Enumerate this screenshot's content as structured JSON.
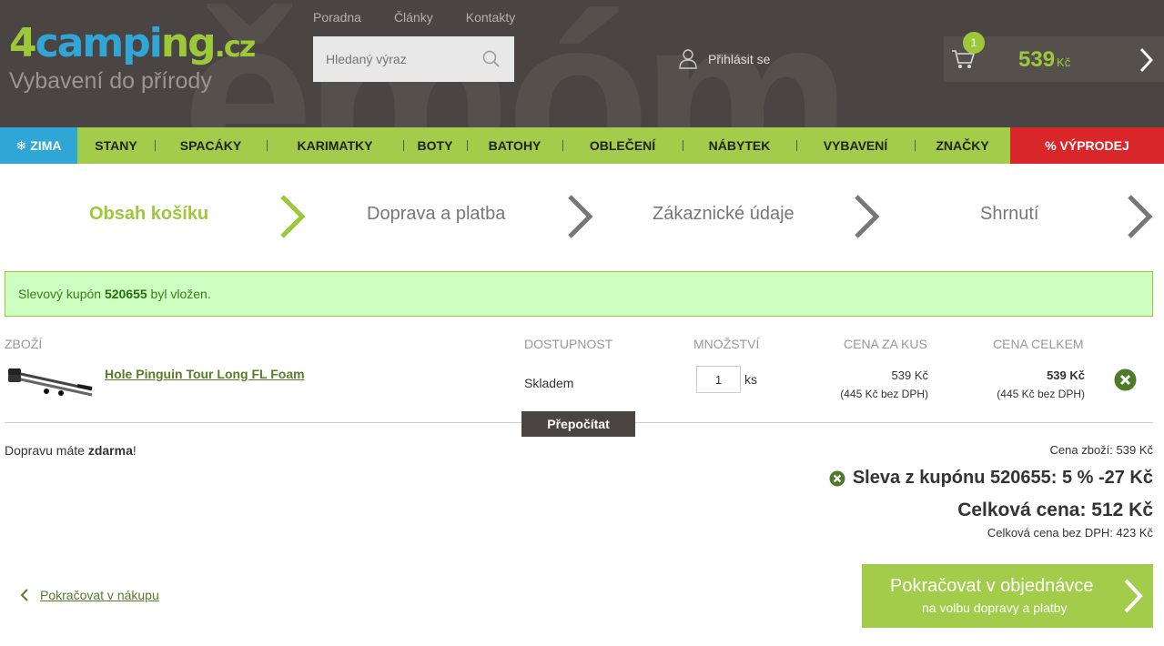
{
  "header": {
    "logo": {
      "four": "4",
      "camp": "campi",
      "ng": "ng",
      "cz": ".cz",
      "tagline": "Vybavení do přírody"
    },
    "toplinks": [
      "Poradna",
      "Články",
      "Kontakty"
    ],
    "search": {
      "placeholder": "Hledaný výraz"
    },
    "login_label": "Přihlásit se",
    "cart": {
      "count": "1",
      "price": "539",
      "currency": "Kč"
    }
  },
  "nav": {
    "zima": "ZIMA",
    "items": [
      "STANY",
      "SPACÁKY",
      "KARIMATKY",
      "BOTY",
      "BATOHY",
      "OBLEČENÍ",
      "NÁBYTEK",
      "VYBAVENÍ",
      "ZNAČKY"
    ],
    "sale": "% VÝPRODEJ"
  },
  "steps": [
    "Obsah košíku",
    "Doprava a platba",
    "Zákaznické údaje",
    "Shrnutí"
  ],
  "alert": {
    "prefix": "Slevový kupón ",
    "code": "520655",
    "suffix": " byl vložen."
  },
  "table": {
    "headers": {
      "product": "ZBOŽÍ",
      "availability": "DOSTUPNOST",
      "quantity": "MNOŽSTVÍ",
      "unit_price": "CENA ZA KUS",
      "total": "CENA CELKEM"
    },
    "row": {
      "name": "Hole Pinguin Tour Long FL Foam",
      "availability": "Skladem",
      "quantity": "1",
      "unit": "ks",
      "unit_price": "539 Kč",
      "unit_price_net": "(445 Kč bez DPH)",
      "total_price": "539 Kč",
      "total_price_net": "(445 Kč bez DPH)"
    },
    "recalc_label": "Přepočítat"
  },
  "summary": {
    "shipping_prefix": "Dopravu máte ",
    "shipping_bold": "zdarma",
    "shipping_suffix": "!",
    "goods_price": "Cena zboží: 539 Kč",
    "coupon_line": "Sleva z kupónu 520655: 5 % -27 Kč",
    "grand_total": "Celková cena: 512 Kč",
    "net_total": "Celková cena bez DPH: 423 Kč"
  },
  "actions": {
    "back_label": "Pokračovat v nákupu",
    "continue_title": "Pokračovat v objednávce",
    "continue_sub": "na volbu dopravy a platby"
  },
  "colors": {
    "accent": "#a2cc4a",
    "blue": "#2fa6d6",
    "sale": "#d8262a",
    "header": "#4a4542"
  }
}
